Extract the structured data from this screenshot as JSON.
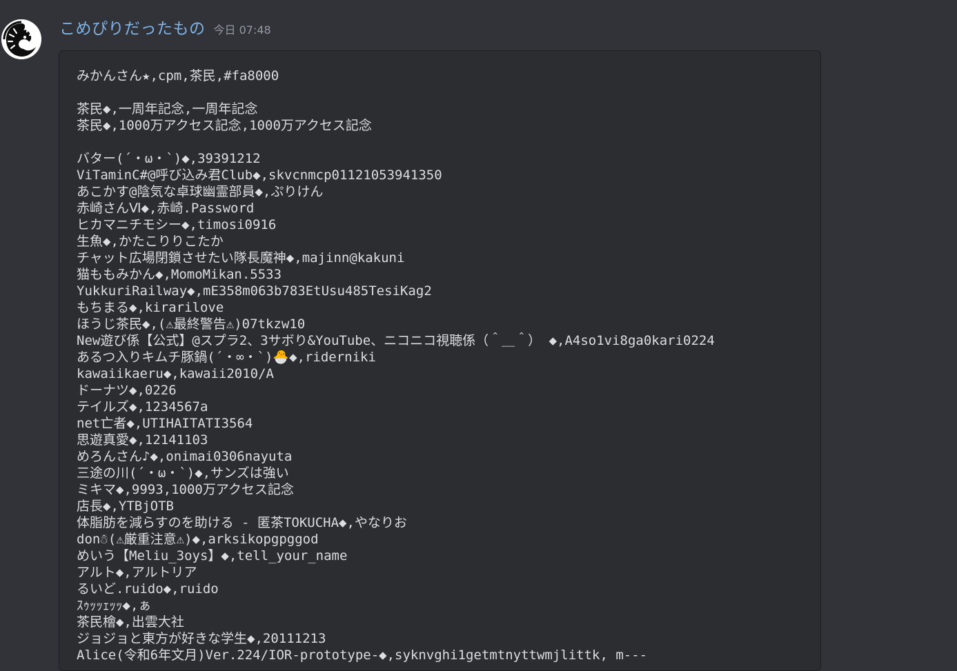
{
  "message": {
    "username": "こめぴりだったもの",
    "timestamp": "今日 07:48",
    "code_lines": [
      "みかんさん★,cpm,茶民,#fa8000",
      "",
      "茶民◆,一周年記念,一周年記念",
      "茶民◆,1000万アクセス記念,1000万アクセス記念",
      "",
      "バター(´・ω・`)◆,39391212",
      "ViTaminC#@呼び込み君Club◆,skvcnmcp01121053941350",
      "あこかす@陰気な卓球幽霊部員◆,ぷりけん",
      "赤崎さんⅥ◆,赤崎.Password",
      "ヒカマニチモシー◆,timosi0916",
      "生魚◆,かたこりりこたか",
      "チャット広場閉鎖させたい隊長魔神◆,majinn@kakuni",
      "猫ももみかん◆,MomoMikan.5533",
      "YukkuriRailway◆,mE358m063b783EtUsu485TesiKag2",
      "もちまる◆,kirarilove",
      "ほうじ茶民◆,(⚠最終警告⚠)07tkzw10",
      "New遊び係【公式】@スプラ2、3サボり&YouTube、ニコニコ視聴係（＾＿＾） ◆,A4so1vi8ga0kari0224",
      "あるつ入りキムチ豚鍋(´・∞・`)🐣◆,riderniki",
      "kawaiikaeru◆,kawaii2010/A",
      "ドーナツ◆,0226",
      "テイルズ◆,1234567a",
      "net亡者◆,UTIHAITATI3564",
      "思遊真愛◆,12141103",
      "めろんさん♪◆,onimai0306nayuta",
      "三途の川(´・ω・`)◆,サンズは強い",
      "ミキマ◆,9993,1000万アクセス記念",
      "店長◆,YTBjOTB",
      "体脂肪を減らすのを助ける - 匿茶TOKUCHA◆,やなりお",
      "don☃(⚠厳重注意⚠)◆,arksikopgpggod",
      "めいう【Meliu_3oys】◆,tell_your_name",
      "アルト◆,アルトリア",
      "るいど.ruido◆,ruido",
      "ｽｩｯｯｪｯｯ◆,ぁ",
      "茶民檜◆,出雲大社",
      "ジョジョと東方が好きな学生◆,20111213",
      "Alice(令和6年文月)Ver.224/IOR-prototype-◆,syknvghi1getmtnyttwmjlittk, m---"
    ]
  },
  "colors": {
    "background": "#313338",
    "codeblock": "#2b2d31",
    "username": "#7fb3e6",
    "timestamp": "#949ba4",
    "text": "#dbdee1"
  },
  "icons": {
    "avatar": "avatar-image"
  }
}
